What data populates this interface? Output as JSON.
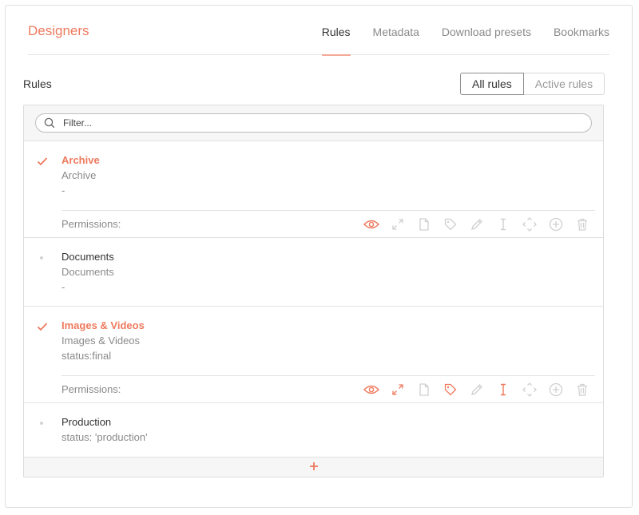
{
  "header": {
    "title": "Designers",
    "tabs": [
      "Rules",
      "Metadata",
      "Download presets",
      "Bookmarks"
    ],
    "active_tab": "Rules"
  },
  "section": {
    "label": "Rules",
    "toggle": {
      "all": "All rules",
      "active": "Active rules",
      "selected": "All rules"
    }
  },
  "filter": {
    "placeholder": "Filter..."
  },
  "rules": [
    {
      "name": "Archive",
      "description": "Archive",
      "query": "-",
      "active": true,
      "permissions_label": "Permissions:",
      "permissions": {
        "view": true,
        "expand": false,
        "file": false,
        "tag": false,
        "edit": false,
        "text": false,
        "move": false,
        "add": false,
        "delete": false
      }
    },
    {
      "name": "Documents",
      "description": "Documents",
      "query": "-",
      "active": false
    },
    {
      "name": "Images & Videos",
      "description": "Images & Videos",
      "query": "status:final",
      "active": true,
      "permissions_label": "Permissions:",
      "permissions": {
        "view": true,
        "expand": true,
        "file": false,
        "tag": true,
        "edit": false,
        "text": true,
        "move": false,
        "add": false,
        "delete": false
      }
    },
    {
      "name": "Production",
      "description": "status: 'production'",
      "active": false
    }
  ],
  "colors": {
    "accent": "#ee7a5e",
    "muted_icon": "#cfcfcf",
    "border": "#e2e2e2",
    "panel_bg": "#f6f6f6"
  },
  "icons": [
    "search-icon",
    "checkmark-icon",
    "eye-icon",
    "expand-icon",
    "file-icon",
    "tag-icon",
    "pencil-icon",
    "text-cursor-icon",
    "move-icon",
    "plus-circle-icon",
    "trash-icon",
    "add-icon"
  ]
}
